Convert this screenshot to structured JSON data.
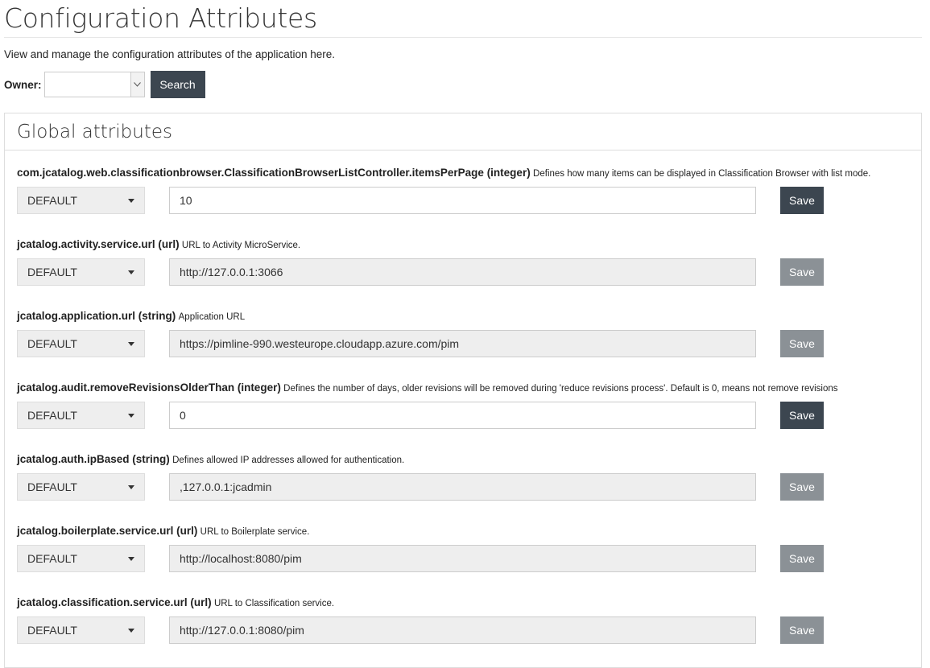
{
  "header": {
    "title": "Configuration Attributes",
    "subtitle": "View and manage the configuration attributes of the application here."
  },
  "filter": {
    "owner_label": "Owner:",
    "owner_value": "",
    "search_label": "Search"
  },
  "panel": {
    "title": "Global attributes"
  },
  "attributes": [
    {
      "name": "com.jcatalog.web.classificationbrowser.ClassificationBrowserListController.itemsPerPage (integer)",
      "description": "Defines how many items can be displayed in Classification Browser with list mode.",
      "scope": "DEFAULT",
      "value": "10",
      "editable": true,
      "save_label": "Save"
    },
    {
      "name": "jcatalog.activity.service.url (url)",
      "description": "URL to Activity MicroService.",
      "scope": "DEFAULT",
      "value": "http://127.0.0.1:3066",
      "editable": false,
      "save_label": "Save"
    },
    {
      "name": "jcatalog.application.url (string)",
      "description": "Application URL",
      "scope": "DEFAULT",
      "value": "https://pimline-990.westeurope.cloudapp.azure.com/pim",
      "editable": false,
      "save_label": "Save"
    },
    {
      "name": "jcatalog.audit.removeRevisionsOlderThan (integer)",
      "description": "Defines the number of days, older revisions will be removed during 'reduce revisions process'. Default is 0, means not remove revisions",
      "scope": "DEFAULT",
      "value": "0",
      "editable": true,
      "save_label": "Save"
    },
    {
      "name": "jcatalog.auth.ipBased (string)",
      "description": "Defines allowed IP addresses allowed for authentication.",
      "scope": "DEFAULT",
      "value": ",127.0.0.1:jcadmin",
      "editable": false,
      "save_label": "Save"
    },
    {
      "name": "jcatalog.boilerplate.service.url (url)",
      "description": "URL to Boilerplate service.",
      "scope": "DEFAULT",
      "value": "http://localhost:8080/pim",
      "editable": false,
      "save_label": "Save"
    },
    {
      "name": "jcatalog.classification.service.url (url)",
      "description": "URL to Classification service.",
      "scope": "DEFAULT",
      "value": "http://127.0.0.1:8080/pim",
      "editable": false,
      "save_label": "Save"
    }
  ]
}
